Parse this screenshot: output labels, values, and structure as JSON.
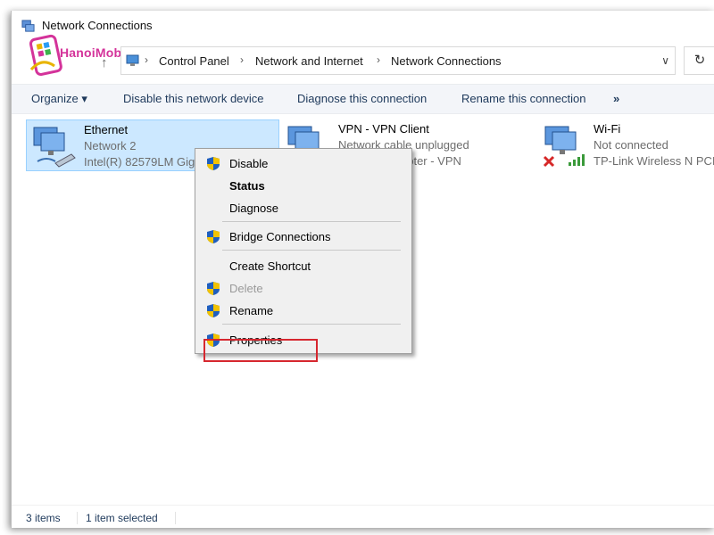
{
  "window": {
    "title": "Network Connections"
  },
  "logo": {
    "text": "HanoiMobile"
  },
  "address_bar": {
    "crumbs": [
      "Control Panel",
      "Network and Internet",
      "Network Connections"
    ],
    "separator": "›"
  },
  "toolbar": {
    "organize": "Organize ▾",
    "disable": "Disable this network device",
    "diagnose": "Diagnose this connection",
    "rename": "Rename this connection",
    "more": "»"
  },
  "connections": [
    {
      "name": "Ethernet",
      "status": "Network 2",
      "device": "Intel(R) 82579LM Gig",
      "selected": true
    },
    {
      "name": "VPN - VPN Client",
      "status": "Network cable unplugged",
      "device": "apter - VPN",
      "selected": false
    },
    {
      "name": "Wi-Fi",
      "status": "Not connected",
      "device": "TP-Link Wireless N PCI",
      "selected": false
    }
  ],
  "context_menu": {
    "items": [
      {
        "label": "Disable",
        "shield": true
      },
      {
        "label": "Status",
        "bold": true
      },
      {
        "label": "Diagnose"
      },
      {
        "label": "Bridge Connections",
        "shield": true
      },
      {
        "label": "Create Shortcut"
      },
      {
        "label": "Delete",
        "shield": true,
        "disabled": true
      },
      {
        "label": "Rename",
        "shield": true
      },
      {
        "label": "Properties",
        "shield": true,
        "highlighted": true
      }
    ]
  },
  "status_bar": {
    "items_count": "3 items",
    "selected": "1 item selected"
  },
  "colors": {
    "selection": "#cce8ff",
    "highlight_box": "#d6272f",
    "toolbar_text": "#1e395b"
  }
}
